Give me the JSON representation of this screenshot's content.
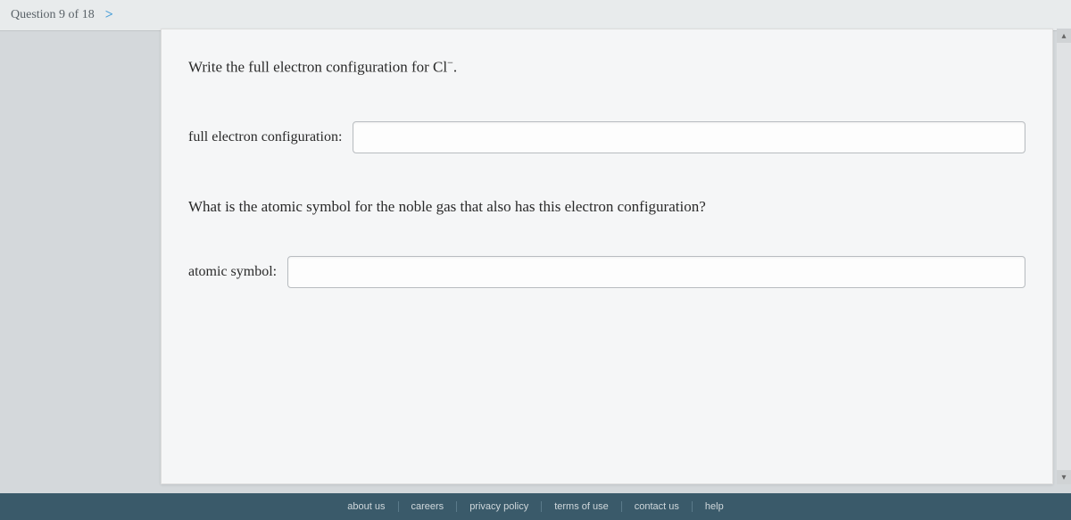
{
  "header": {
    "question_label": "Question 9 of 18",
    "chevron": ">"
  },
  "content": {
    "prompt_prefix": "Write the full electron configuration for ",
    "species": "Cl",
    "species_charge": "−",
    "prompt_suffix": ".",
    "label_config": "full electron configuration:",
    "config_value": "",
    "sub_question": "What is the atomic symbol for the noble gas that also has this electron configuration?",
    "label_symbol": "atomic symbol:",
    "symbol_value": ""
  },
  "scrollbar": {
    "up": "▴",
    "down": "▾"
  },
  "footer": {
    "links": [
      "about us",
      "careers",
      "privacy policy",
      "terms of use",
      "contact us",
      "help"
    ]
  }
}
